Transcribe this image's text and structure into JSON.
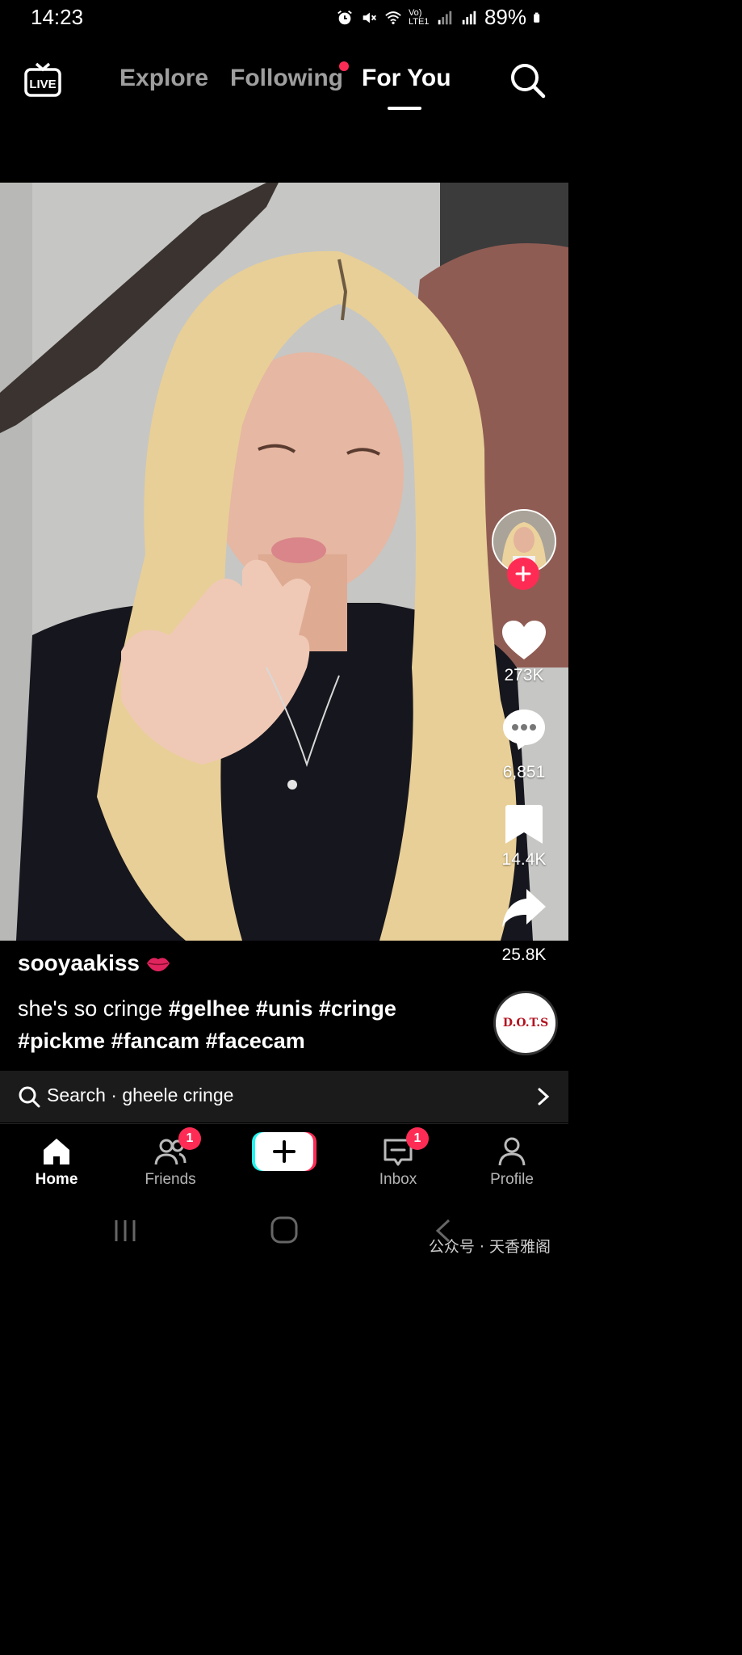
{
  "status_bar": {
    "time": "14:23",
    "network_label": "Vo) LTE1",
    "battery": "89%"
  },
  "top_nav": {
    "tabs": [
      {
        "label": "Explore",
        "active": false
      },
      {
        "label": "Following",
        "active": false,
        "has_dot": true
      },
      {
        "label": "For You",
        "active": true
      }
    ],
    "live_label": "LIVE"
  },
  "video": {
    "username": "sooyaakiss",
    "caption_text": "she's so cringe",
    "hashtags": [
      "#gelhee",
      "#unis",
      "#cringe",
      "#pickme",
      "#fancam",
      "#facecam"
    ],
    "music_disc_text": "D.O.T.S",
    "actions": {
      "likes": "273K",
      "comments": "6,851",
      "saves": "14.4K",
      "shares": "25.8K"
    }
  },
  "search_bar": {
    "text": "Search · gheele cringe"
  },
  "bottom_nav": {
    "items": [
      {
        "label": "Home",
        "active": true
      },
      {
        "label": "Friends",
        "badge": "1"
      },
      {
        "label": "Inbox",
        "badge": "1"
      },
      {
        "label": "Profile"
      }
    ]
  },
  "watermark": {
    "text": "公众号 · 天香雅阁"
  },
  "colors": {
    "accent": "#fe2c55",
    "background": "#000000"
  }
}
